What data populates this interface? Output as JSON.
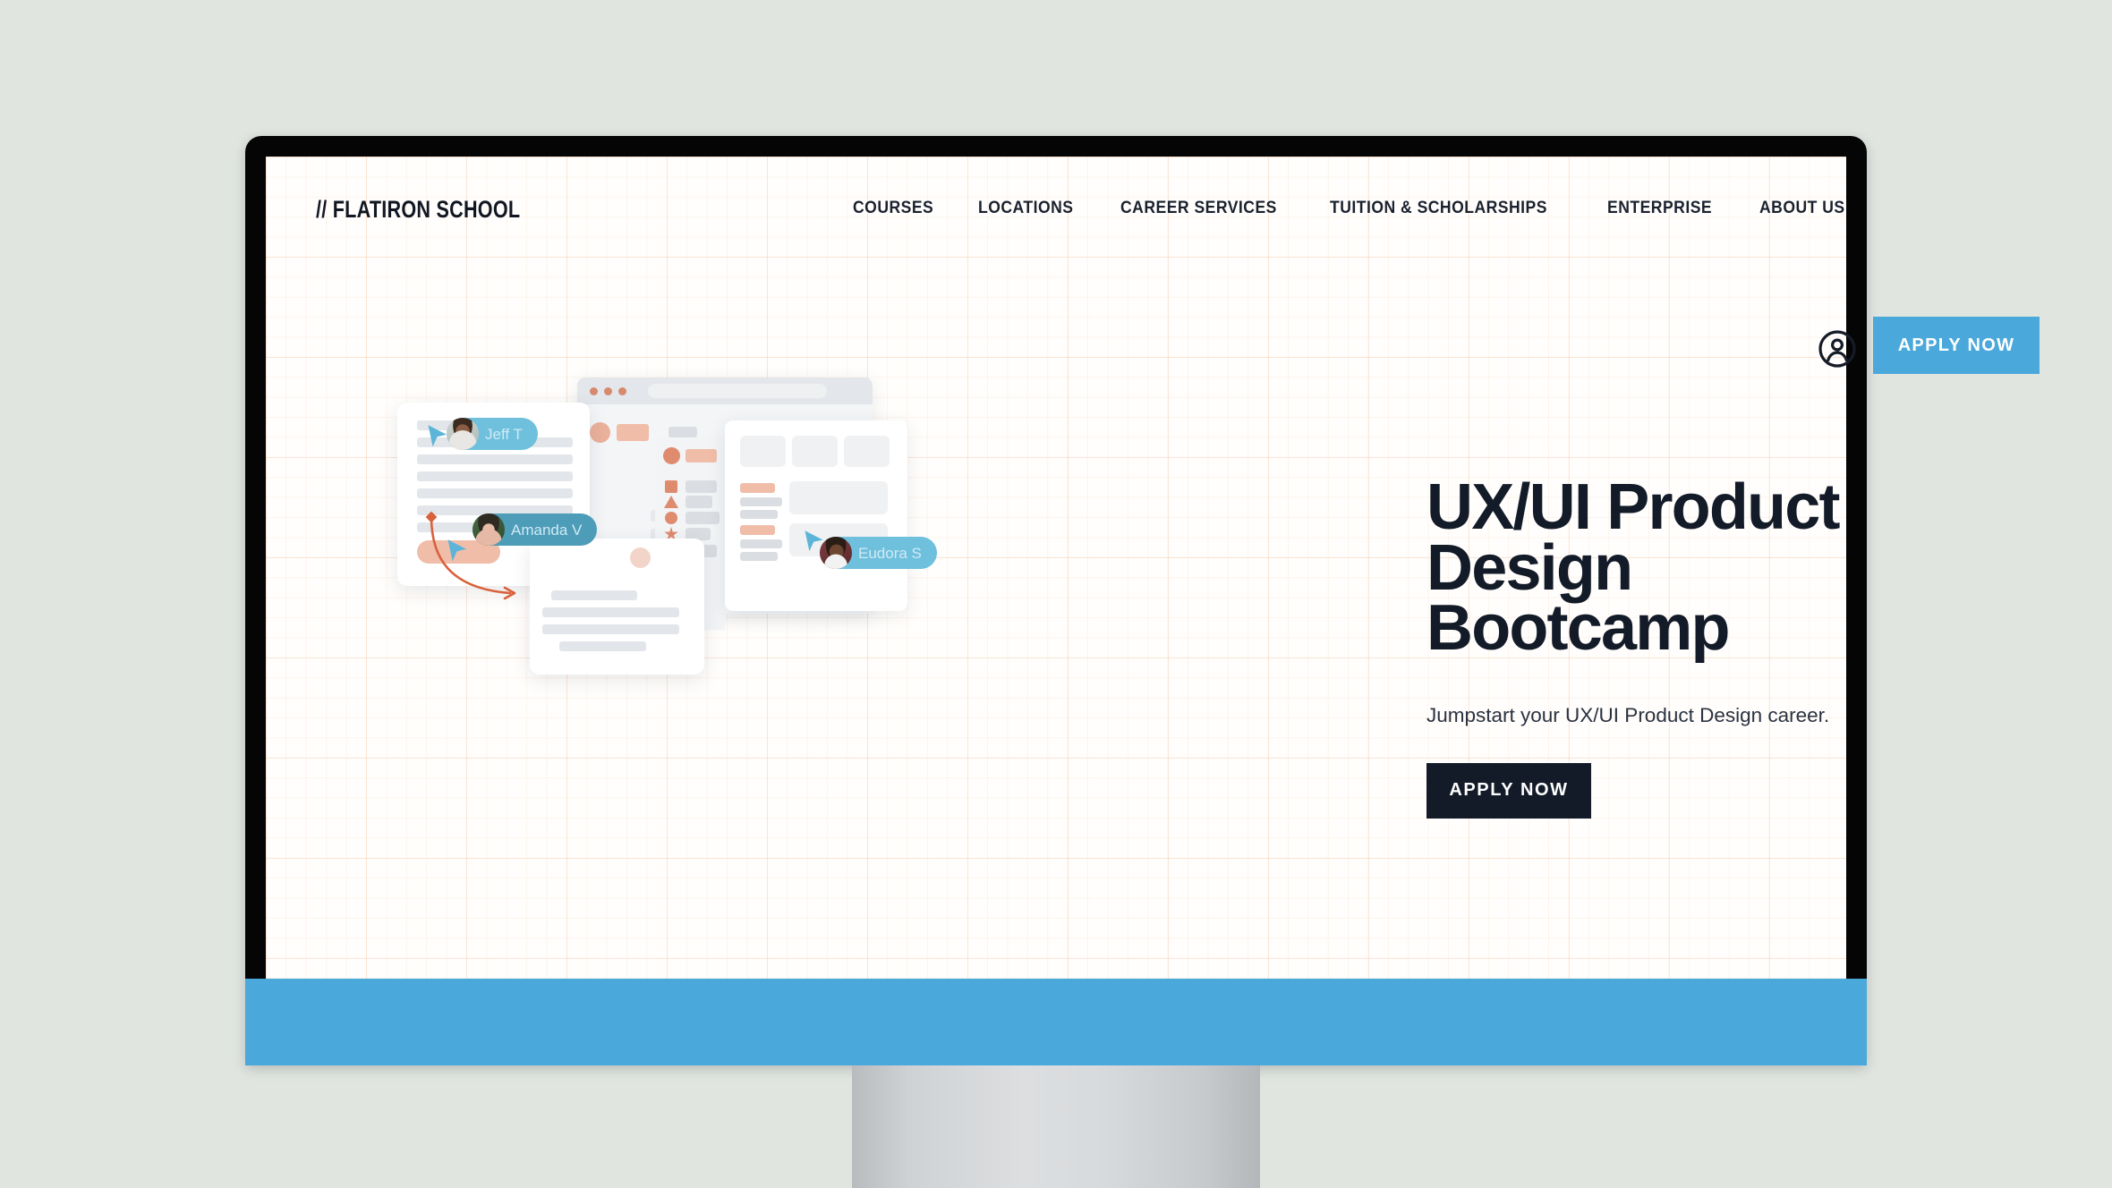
{
  "page": {
    "background_color": "#e0e5e0",
    "accent_blue": "#4aa8db",
    "ink_dark": "#131b29",
    "accent_salmon": "#e5906e"
  },
  "device": {
    "type": "desktop-monitor-mockup",
    "bezel_color": "#050505",
    "stand_color": "#d4d7d9"
  },
  "header": {
    "brand": "// FLATIRON SCHOOL",
    "nav_items": [
      {
        "label": "COURSES"
      },
      {
        "label": "LOCATIONS"
      },
      {
        "label": "CAREER SERVICES"
      },
      {
        "label": "TUITION & SCHOLARSHIPS"
      },
      {
        "label": "ENTERPRISE"
      },
      {
        "label": "ABOUT US"
      }
    ],
    "account_icon": "account-circle-icon",
    "apply_button_label": "APPLY NOW"
  },
  "hero": {
    "heading": "UX/UI Product\nDesign\nBootcamp",
    "subtitle": "Jumpstart your UX/UI Product Design career.",
    "cta_label": "APPLY NOW"
  },
  "illustration": {
    "description": "collaborative design-tool mockup windows",
    "collaborators": [
      {
        "name": "Jeff T",
        "chip_color": "#6fc0dd",
        "cursor_color": "#4aa8db"
      },
      {
        "name": "Amanda V",
        "chip_color": "#4d9cb8",
        "cursor_color": "#4aa8db"
      },
      {
        "name": "Eudora S",
        "chip_color": "#6fc0dd",
        "cursor_color": "#4aa8db"
      }
    ],
    "tool_panel_icons": [
      "square-icon",
      "triangle-icon",
      "circle-icon",
      "star-icon",
      "pentagon-icon"
    ],
    "browser_dots": 3
  },
  "footer_band": {
    "color": "#4aa8db"
  }
}
